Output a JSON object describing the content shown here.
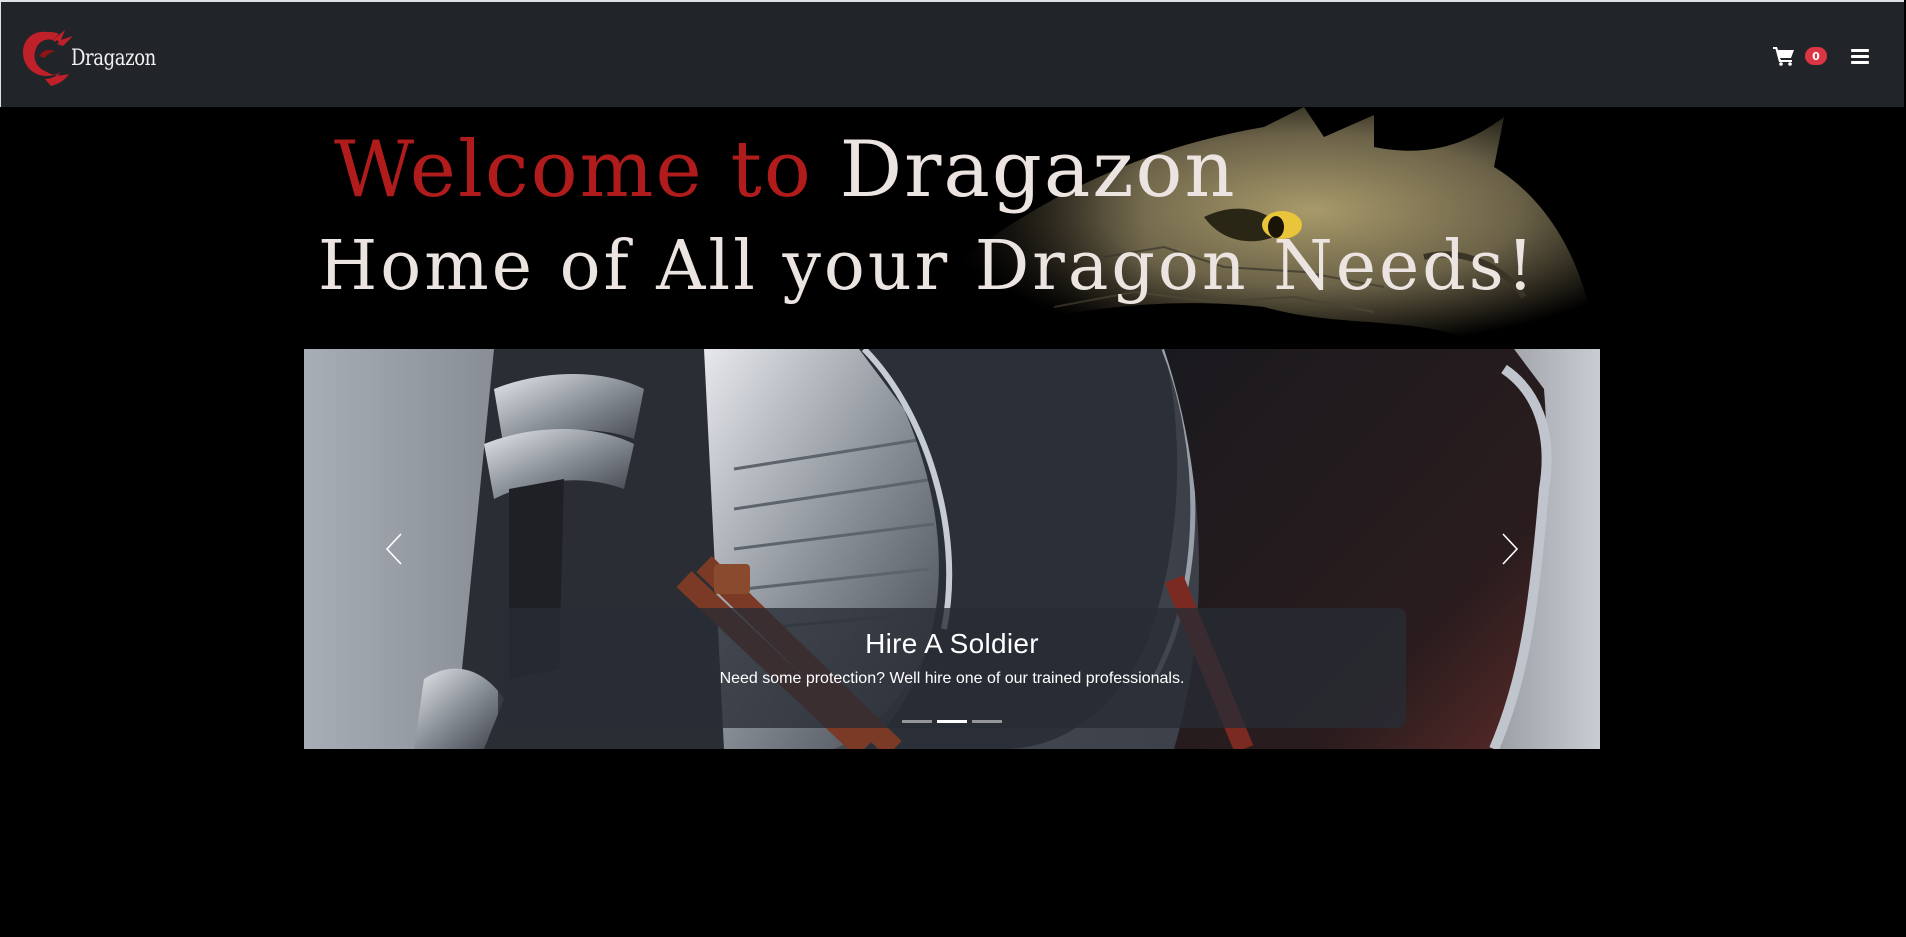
{
  "navbar": {
    "brand_name": "Dragazon",
    "cart_count": "0",
    "cart_icon": "shopping-cart-icon",
    "menu_icon": "hamburger-menu-icon",
    "colors": {
      "background": "#212529",
      "badge": "#dc3545"
    }
  },
  "banner": {
    "line1_red": "Welcome to",
    "line1_white": "Dragazon",
    "line2": "Home of All your Dragon Needs!",
    "colors": {
      "red_text": "#b01c1c",
      "white_text": "#ece4e1"
    }
  },
  "carousel": {
    "active_index": 1,
    "slide_count": 3,
    "caption_title": "Hire A Soldier",
    "caption_text": "Need some protection? Well hire one of our trained professionals.",
    "prev_icon": "chevron-left-icon",
    "next_icon": "chevron-right-icon"
  }
}
